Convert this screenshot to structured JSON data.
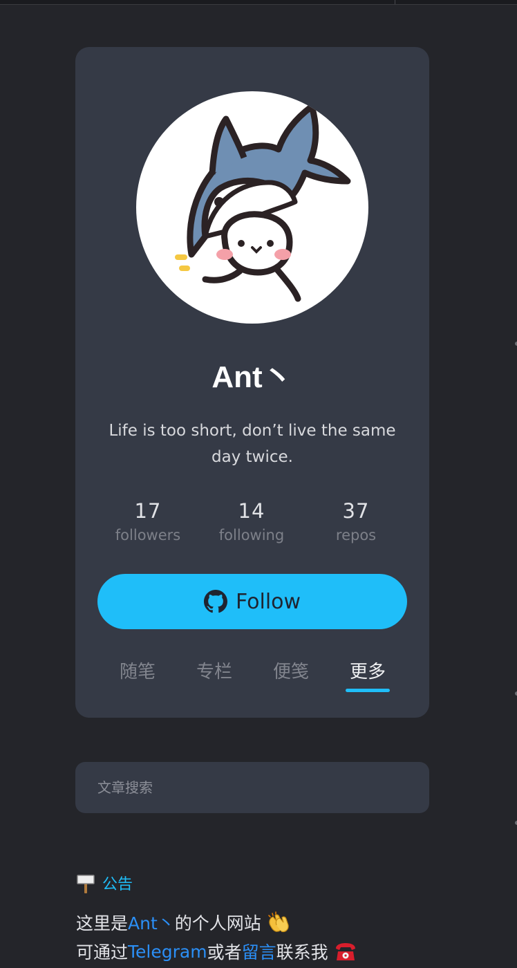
{
  "profile": {
    "name": "Ant丶",
    "bio": "Life is too short, don’t live the same day twice.",
    "stats": [
      {
        "number": "17",
        "label": "followers"
      },
      {
        "number": "14",
        "label": "following"
      },
      {
        "number": "37",
        "label": "repos"
      }
    ],
    "follow_label": "Follow",
    "follow_icon": "github-icon",
    "tabs": [
      {
        "label": "随笔",
        "active": false
      },
      {
        "label": "专栏",
        "active": false
      },
      {
        "label": "便笺",
        "active": false
      },
      {
        "label": "更多",
        "active": true
      }
    ],
    "avatar_icon": "shark-hat-character"
  },
  "search": {
    "placeholder": "文章搜索"
  },
  "notice": {
    "icon": "signpost-icon",
    "title": "公告",
    "line1": {
      "prefix": "这里是",
      "link": "Ant丶",
      "suffix": "的个人网站",
      "emoji": "clapping-hands-icon"
    },
    "line2": {
      "prefix": "可通过",
      "link1": "Telegram",
      "middle": "或者",
      "link2": "留言",
      "suffix": "联系我",
      "emoji": "telephone-icon"
    }
  },
  "colors": {
    "page_background": "#24252a",
    "card_background": "#353a46",
    "accent": "#1fbef9",
    "link": "#2b8ff6"
  }
}
